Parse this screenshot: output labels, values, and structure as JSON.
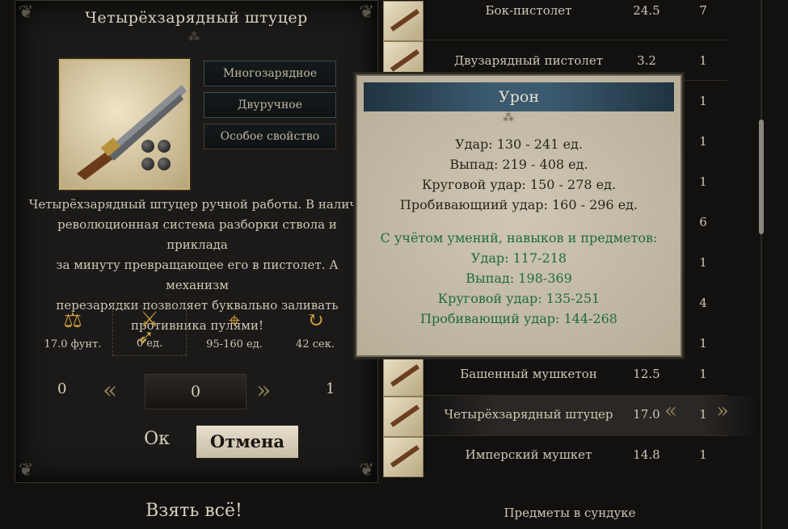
{
  "item": {
    "title": "Четырёхзарядный штуцер",
    "tags": [
      "Многозарядное",
      "Двуручное",
      "Особое свойство"
    ],
    "description_lines": [
      "Четырёхзарядный штуцер ручной работы. В наличи",
      "революционная система разборки ствола и приклада",
      "за минуту превращающее его в пистолет. А механизм",
      "перезарядки позволяет буквально заливать",
      "противника пулями!"
    ],
    "stats": {
      "weight": "17.0 фунт.",
      "damage": "0 ед.",
      "accuracy": "95-160 ед.",
      "reload": "42 сек."
    },
    "quantity": {
      "min": "0",
      "current": "0",
      "max": "1"
    },
    "ok_label": "Ок",
    "cancel_label": "Отмена",
    "take_all_label": "Взять всё!"
  },
  "list": {
    "rows": [
      {
        "name": "Бок-пистолет",
        "weight": "24.5",
        "count": "7"
      },
      {
        "name": "Двузарядный пистолет",
        "weight": "3.2",
        "count": "1"
      },
      {
        "name": "",
        "weight": "",
        "count": "1"
      },
      {
        "name": "",
        "weight": "",
        "count": "1"
      },
      {
        "name": "",
        "weight": "",
        "count": "1"
      },
      {
        "name": "",
        "weight": "",
        "count": "6"
      },
      {
        "name": "",
        "weight": "",
        "count": "1"
      },
      {
        "name": "",
        "weight": "",
        "count": "4"
      },
      {
        "name": "",
        "weight": "",
        "count": "1"
      },
      {
        "name": "Башенный мушкетон",
        "weight": "12.5",
        "count": "1"
      },
      {
        "name": "Четырёхзарядный штуцер",
        "weight": "17.0",
        "count": "1"
      },
      {
        "name": "Имперский мушкет",
        "weight": "14.8",
        "count": "1"
      }
    ],
    "chest_label": "Предметы в сундуке"
  },
  "tooltip": {
    "title": "Урон",
    "base": [
      "Удар: 130 - 241 ед.",
      "Выпад: 219 - 408 ед.",
      "Круговой удар: 150 - 278 ед.",
      "Пробивающиий удар: 160 - 296 ед."
    ],
    "skills_header": "С учётом умений, навыков и предметов:",
    "skills": [
      "Удар: 117-218",
      "Выпад: 198-369",
      "Круговой удар: 135-251",
      "Пробивающий удар: 144-268"
    ]
  },
  "colors": {
    "accent_gold": "#c79a3c",
    "tooltip_green": "#1f6b3a",
    "tooltip_header": "#3b5a6f"
  }
}
